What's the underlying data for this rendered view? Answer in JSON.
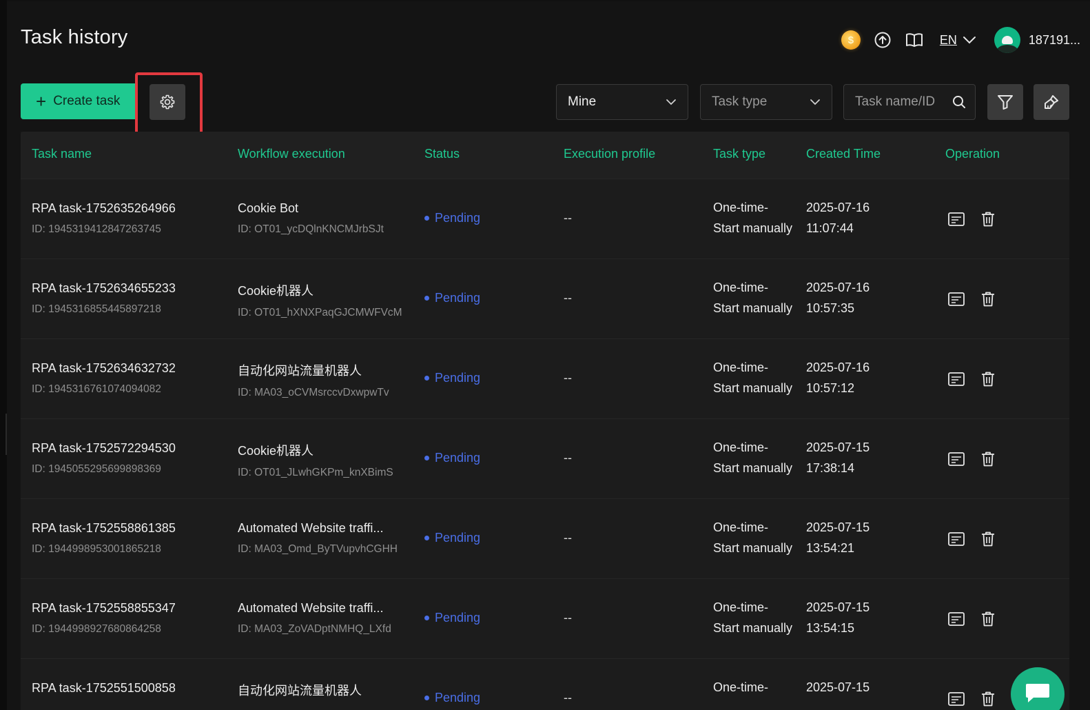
{
  "header": {
    "title": "Task history",
    "language": "EN",
    "username": "187191..."
  },
  "toolbar": {
    "create_label": "Create task",
    "owner_filter": "Mine",
    "task_type_placeholder": "Task type",
    "search_placeholder": "Task name/ID"
  },
  "table": {
    "columns": [
      "Task name",
      "Workflow execution",
      "Status",
      "Execution profile",
      "Task type",
      "Created Time",
      "Operation"
    ],
    "rows": [
      {
        "name": "RPA task-1752635264966",
        "id": "ID: 1945319412847263745",
        "workflow": "Cookie Bot",
        "workflow_id": "ID: OT01_ycDQlnKNCMJrbSJt",
        "status": "Pending",
        "profile": "--",
        "type_line1": "One-time-",
        "type_line2": "Start manually",
        "date": "2025-07-16",
        "time": "11:07:44"
      },
      {
        "name": "RPA task-1752634655233",
        "id": "ID: 1945316855445897218",
        "workflow": "Cookie机器人",
        "workflow_id": "ID: OT01_hXNXPaqGJCMWFVcM",
        "status": "Pending",
        "profile": "--",
        "type_line1": "One-time-",
        "type_line2": "Start manually",
        "date": "2025-07-16",
        "time": "10:57:35"
      },
      {
        "name": "RPA task-1752634632732",
        "id": "ID: 1945316761074094082",
        "workflow": "自动化网站流量机器人",
        "workflow_id": "ID: MA03_oCVMsrccvDxwpwTv",
        "status": "Pending",
        "profile": "--",
        "type_line1": "One-time-",
        "type_line2": "Start manually",
        "date": "2025-07-16",
        "time": "10:57:12"
      },
      {
        "name": "RPA task-1752572294530",
        "id": "ID: 1945055295699898369",
        "workflow": "Cookie机器人",
        "workflow_id": "ID: OT01_JLwhGKPm_knXBimS",
        "status": "Pending",
        "profile": "--",
        "type_line1": "One-time-",
        "type_line2": "Start manually",
        "date": "2025-07-15",
        "time": "17:38:14"
      },
      {
        "name": "RPA task-1752558861385",
        "id": "ID: 1944998953001865218",
        "workflow": "Automated Website traffi...",
        "workflow_id": "ID: MA03_Omd_ByTVupvhCGHH",
        "status": "Pending",
        "profile": "--",
        "type_line1": "One-time-",
        "type_line2": "Start manually",
        "date": "2025-07-15",
        "time": "13:54:21"
      },
      {
        "name": "RPA task-1752558855347",
        "id": "ID: 1944998927680864258",
        "workflow": "Automated Website traffi...",
        "workflow_id": "ID: MA03_ZoVADptNMHQ_LXfd",
        "status": "Pending",
        "profile": "--",
        "type_line1": "One-time-",
        "type_line2": "Start manually",
        "date": "2025-07-15",
        "time": "13:54:15"
      },
      {
        "name": "RPA task-1752551500858",
        "id": "",
        "workflow": "自动化网站流量机器人",
        "workflow_id": "",
        "status": "Pending",
        "profile": "--",
        "type_line1": "One-time-",
        "type_line2": "",
        "date": "2025-07-15",
        "time": ""
      }
    ]
  },
  "colors": {
    "accent": "#1fc990",
    "status_pending": "#4a6ee6",
    "highlight": "#e2393f"
  },
  "icons": {
    "coin": "coin-icon",
    "upload": "upload-icon",
    "docs": "book-icon",
    "settings": "gear-icon",
    "filter": "filter-icon",
    "clear": "brush-icon",
    "detail": "detail-icon",
    "delete": "trash-icon",
    "chat": "chat-icon"
  }
}
